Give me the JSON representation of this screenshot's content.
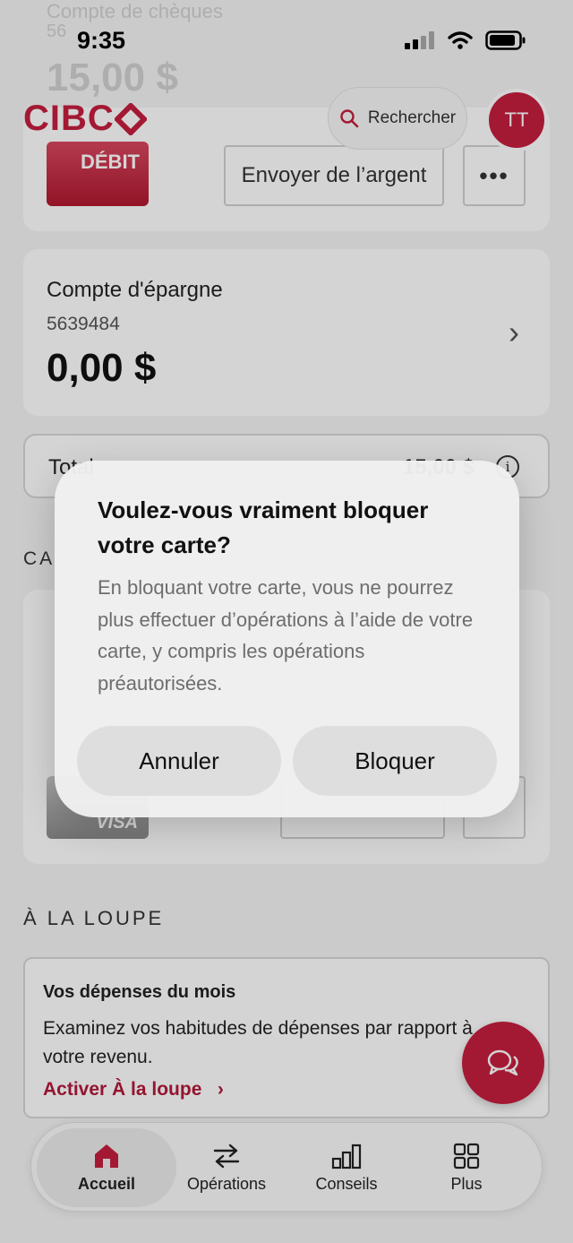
{
  "status_bar": {
    "time": "9:35"
  },
  "header": {
    "logo": "CIBC",
    "search_label": "Rechercher",
    "avatar_initials": "TT"
  },
  "chequing": {
    "name_partial": "Compte de chèques",
    "number_partial": "56",
    "amount": "15,00 $",
    "card_label": "DÉBIT",
    "send_money_label": "Envoyer de l’argent",
    "more_label": "•••"
  },
  "savings": {
    "name": "Compte d'épargne",
    "number": "5639484",
    "amount": "0,00 $"
  },
  "total": {
    "label": "Total",
    "amount": "15,00 $"
  },
  "cards_section": {
    "heading": "CA",
    "visa_label": "VISA"
  },
  "loupe": {
    "heading": "À LA LOUPE",
    "title": "Vos dépenses du mois",
    "description": "Examinez vos habitudes de dépenses par rapport à votre revenu.",
    "link": "Activer À la loupe"
  },
  "tabs": [
    {
      "label": "Accueil",
      "active": true
    },
    {
      "label": "Opérations",
      "active": false
    },
    {
      "label": "Conseils",
      "active": false
    },
    {
      "label": "Plus",
      "active": false
    }
  ],
  "dialog": {
    "title": "Voulez-vous vraiment bloquer votre carte?",
    "message": "En bloquant votre carte, vous ne pourrez plus effectuer d’opérations à l’aide de votre carte, y compris les opérations préautorisées.",
    "cancel_label": "Annuler",
    "confirm_label": "Bloquer"
  },
  "colors": {
    "brand": "#c41f3e",
    "link": "#b3193a"
  }
}
